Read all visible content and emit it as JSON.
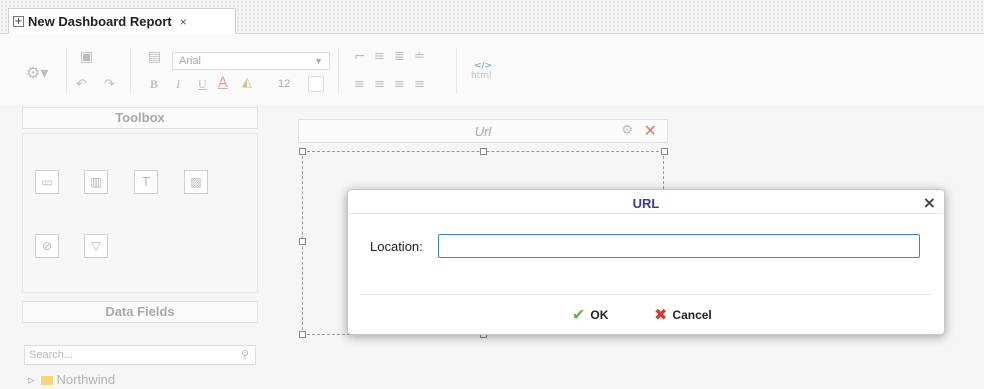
{
  "tab": {
    "title": "New Dashboard Report",
    "close": "×",
    "plus": "+"
  },
  "toolbar": {
    "font_name": "Arial",
    "font_size": "12",
    "html_label": "html",
    "html_code_glyph": "</>",
    "bold_glyph": "B",
    "italic_glyph": "I",
    "underline_glyph": "U",
    "color_glyph": "A"
  },
  "toolbox": {
    "title": "Toolbox",
    "text_tool_glyph": "T"
  },
  "datafields": {
    "title": "Data Fields",
    "search_placeholder": "Search...",
    "tree_item": "Northwind"
  },
  "widget": {
    "title": "Url"
  },
  "modal": {
    "title": "URL",
    "close": "×",
    "location_label": "Location:",
    "location_value": "",
    "ok_label": "OK",
    "cancel_label": "Cancel",
    "ok_icon": "✔",
    "cancel_icon": "✖"
  },
  "colors": {
    "title_blue": "#3b3b99",
    "ok_green": "#5ab83a",
    "cancel_red": "#d63a2a",
    "focus_blue": "#3d80d1"
  }
}
